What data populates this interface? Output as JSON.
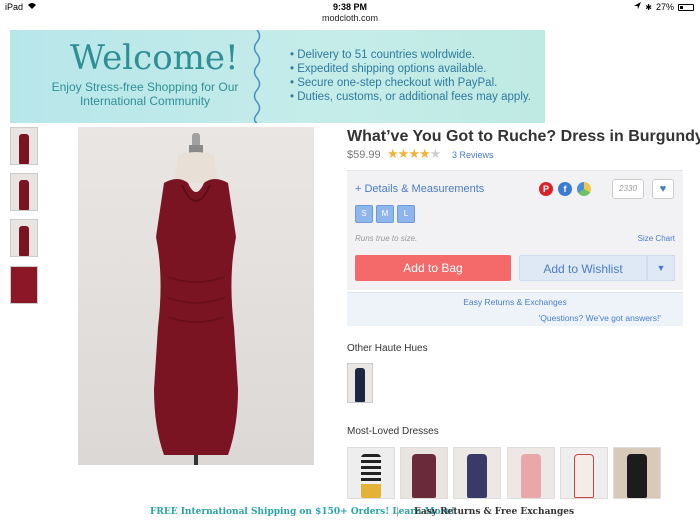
{
  "status": {
    "device": "iPad",
    "time": "9:38 PM",
    "battery": "27%",
    "battery_level": 0.27
  },
  "browser": {
    "url": "modcloth.com"
  },
  "banner": {
    "welcome": "Welcome!",
    "subtitle": "Enjoy Stress-free Shopping for Our International Community",
    "bullets": [
      "Delivery to 51 countries wolrdwide.",
      "Expedited shipping options available.",
      "Secure one-step checkout with PayPal.",
      "Duties, customs, or additional fees may apply."
    ]
  },
  "product": {
    "title": "What’ve You Got to Ruche? Dress in Burgundy",
    "price": "$59.99",
    "rating": 4,
    "rating_max": 5,
    "reviews": "3 Reviews",
    "details_label": "+ Details & Measurements",
    "save_count": "2330",
    "sizes": [
      "S",
      "M",
      "L"
    ],
    "runs_true": "Runs true to size.",
    "size_chart": "Size Chart",
    "add_to_bag": "Add to Bag",
    "add_to_wishlist": "Add to Wishlist",
    "easy_returns": "Easy Returns & Exchanges",
    "questions": "'Questions? We've got answers!'"
  },
  "other_hues": {
    "title": "Other Haute Hues"
  },
  "most_loved": {
    "title": "Most-Loved Dresses"
  },
  "footer": {
    "shipping": "FREE International Shipping on $150+ Orders! Learn More!",
    "separator": "|",
    "returns": "Easy Returns & Free Exchanges"
  },
  "colors": {
    "accent_teal": "#2f8f95",
    "link_blue": "#4a7dc8",
    "bag_red": "#f46a6a",
    "dress_burgundy": "#7a1322"
  }
}
